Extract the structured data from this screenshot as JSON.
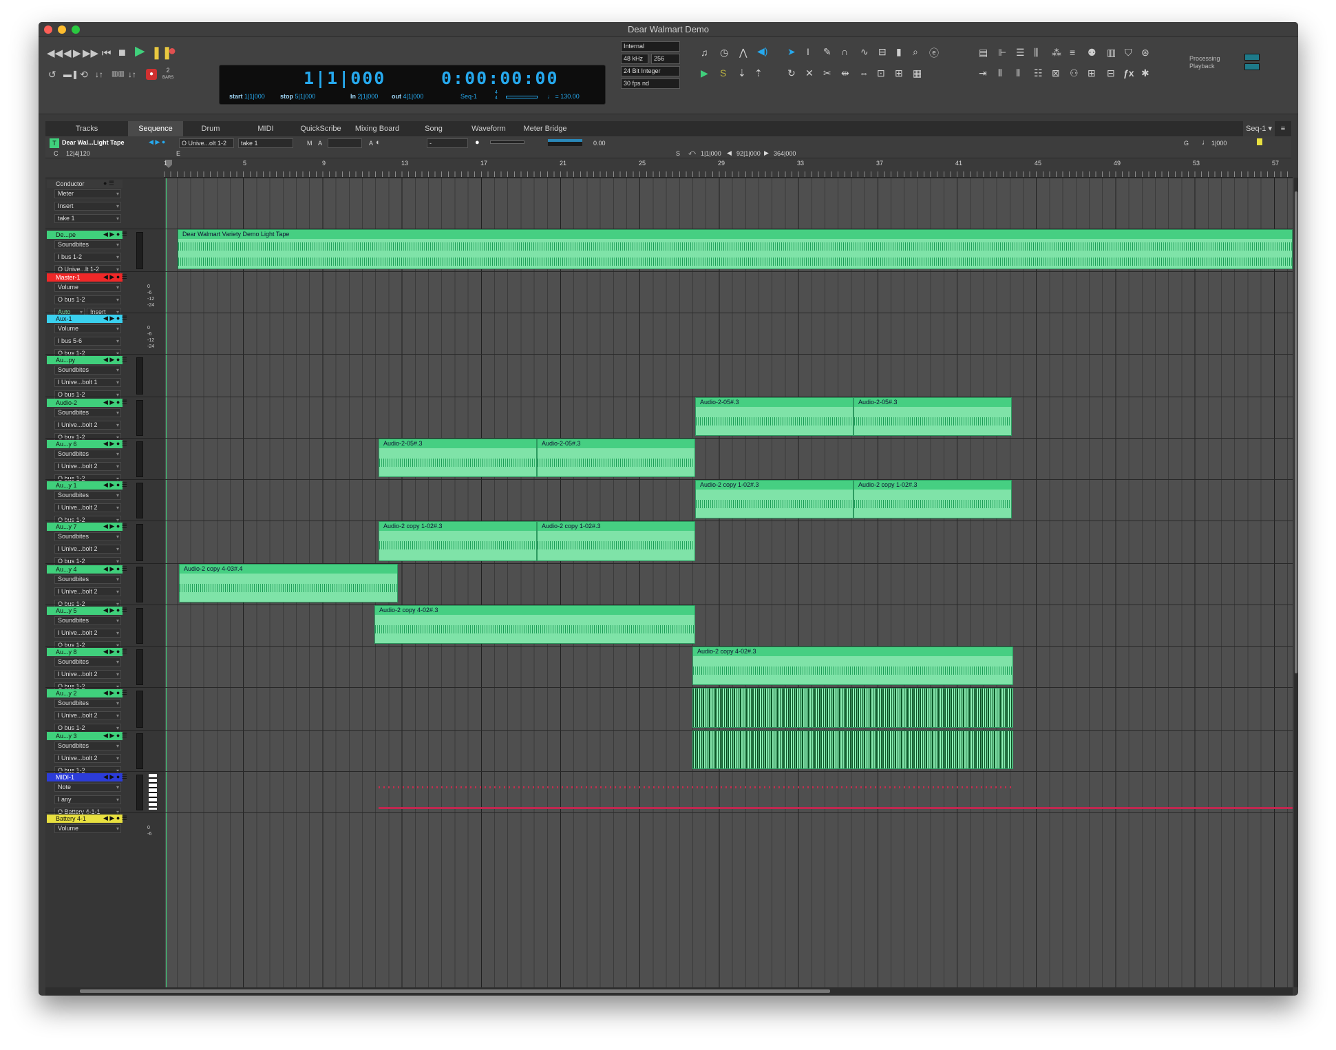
{
  "window": {
    "title": "Dear Walmart Demo"
  },
  "transport": {
    "main_counter": "1|1|000",
    "sub_counter": "0:00:00:00",
    "start_label": "start",
    "start_value": "1|1|000",
    "stop_label": "stop",
    "stop_value": "5|1|000",
    "in_label": "In",
    "in_value": "2|1|000",
    "out_label": "out",
    "out_value": "4|1|000",
    "seq_name": "Seq-1",
    "meter_top": "4",
    "meter_bottom": "4",
    "tempo": "130.00",
    "bars_num": "2",
    "bars_label": "BARS"
  },
  "sync": {
    "clock": "Internal",
    "rate": "48 kHz",
    "buffer": "256",
    "bitdepth": "24 Bit Integer",
    "fps": "30 fps nd"
  },
  "processing": {
    "line1": "Processing",
    "line2": "Playback"
  },
  "tabs": [
    "Tracks",
    "Sequence",
    "Drum",
    "MIDI",
    "QuickScribe",
    "Mixing Board",
    "Song",
    "Waveform",
    "Meter Bridge"
  ],
  "active_tab": "Sequence",
  "seq_menu": "Seq-1",
  "track_header": {
    "T": "T",
    "name": "Dear Wal...Light Tape",
    "output": "O Unive...olt 1-2",
    "take": "take 1",
    "M": "M",
    "A": "A",
    "A2": "A",
    "minus": "-",
    "vol": "0.00",
    "C": "C",
    "cval": "12|4|120",
    "E": "E",
    "S": "S",
    "loc1": "1|1|000",
    "loc2": "92|1|000",
    "loc3": "364|000",
    "G": "G",
    "gval": "1|000"
  },
  "ruler": [
    "1",
    "5",
    "9",
    "13",
    "17",
    "21",
    "25",
    "29",
    "33",
    "37",
    "41",
    "45",
    "49",
    "53",
    "57"
  ],
  "tracks": [
    {
      "name": "Conductor",
      "color": "#3a3a3a",
      "slots": [
        "Meter",
        "Insert",
        "take 1"
      ]
    },
    {
      "name": "De...pe",
      "color": "#40d07c",
      "slots": [
        "Soundbites",
        "I bus 1-2",
        "O Unive...lt 1-2"
      ]
    },
    {
      "name": "Master-1",
      "color": "#f02828",
      "slots": [
        "Volume",
        "O bus 1-2",
        "Auto"
      ],
      "extra": "Insert",
      "scale": [
        "0",
        "-6",
        "-12",
        "-24"
      ]
    },
    {
      "name": "Aux-1",
      "color": "#3ad0ee",
      "slots": [
        "Volume",
        "I bus 5-6",
        "O bus 1-2"
      ],
      "scale": [
        "0",
        "-6",
        "-12",
        "-24"
      ]
    },
    {
      "name": "Au...py",
      "color": "#40d07c",
      "slots": [
        "Soundbites",
        "I Unive...bolt 1",
        "O bus 1-2"
      ]
    },
    {
      "name": "Audio-2",
      "color": "#40d07c",
      "slots": [
        "Soundbites",
        "I Unive...bolt 2",
        "O bus 1-2"
      ]
    },
    {
      "name": "Au...y 6",
      "color": "#40d07c",
      "slots": [
        "Soundbites",
        "I Unive...bolt 2",
        "O bus 1-2"
      ]
    },
    {
      "name": "Au...y 1",
      "color": "#40d07c",
      "slots": [
        "Soundbites",
        "I Unive...bolt 2",
        "O bus 1-2"
      ]
    },
    {
      "name": "Au...y 7",
      "color": "#40d07c",
      "slots": [
        "Soundbites",
        "I Unive...bolt 2",
        "O bus 1-2"
      ]
    },
    {
      "name": "Au...y 4",
      "color": "#40d07c",
      "slots": [
        "Soundbites",
        "I Unive...bolt 2",
        "O bus 1-2"
      ]
    },
    {
      "name": "Au...y 5",
      "color": "#40d07c",
      "slots": [
        "Soundbites",
        "I Unive...bolt 2",
        "O bus 1-2"
      ]
    },
    {
      "name": "Au...y 8",
      "color": "#40d07c",
      "slots": [
        "Soundbites",
        "I Unive...bolt 2",
        "O bus 1-2"
      ]
    },
    {
      "name": "Au...y 2",
      "color": "#40d07c",
      "slots": [
        "Soundbites",
        "I Unive...bolt 2",
        "O bus 1-2"
      ]
    },
    {
      "name": "Au...y 3",
      "color": "#40d07c",
      "slots": [
        "Soundbites",
        "I Unive...bolt 2",
        "O bus 1-2"
      ]
    },
    {
      "name": "MIDI-1",
      "color": "#2c3cd8",
      "slots": [
        "Note",
        "I any",
        "O Battery 4-1-1"
      ]
    },
    {
      "name": "Battery 4-1",
      "color": "#e8e040",
      "slots": [
        "Volume"
      ],
      "scale": [
        "0",
        "-6"
      ]
    }
  ],
  "clips": [
    {
      "name": "Dear Walmart Variety Demo Light Tape",
      "lane": 1
    },
    {
      "name": "Audio-2-05#.3",
      "lane": 5
    },
    {
      "name": "Audio-2-05#.3",
      "lane": 5
    },
    {
      "name": "Audio-2-05#.3",
      "lane": 6
    },
    {
      "name": "Audio-2-05#.3",
      "lane": 6
    },
    {
      "name": "Audio-2 copy 1-02#.3",
      "lane": 7
    },
    {
      "name": "Audio-2 copy 1-02#.3",
      "lane": 7
    },
    {
      "name": "Audio-2 copy 1-02#.3",
      "lane": 8
    },
    {
      "name": "Audio-2 copy 1-02#.3",
      "lane": 8
    },
    {
      "name": "Audio-2 copy 4-03#.4",
      "lane": 9
    },
    {
      "name": "Audio-2 copy 4-02#.3",
      "lane": 10
    },
    {
      "name": "Audio-2 copy 4-02#.3",
      "lane": 11
    },
    {
      "name": "",
      "lane": 12
    },
    {
      "name": "",
      "lane": 13
    }
  ],
  "colors": {
    "clip_fill": "#7fe3a8",
    "clip_header": "#46cf82",
    "accent": "#26a9ee"
  }
}
